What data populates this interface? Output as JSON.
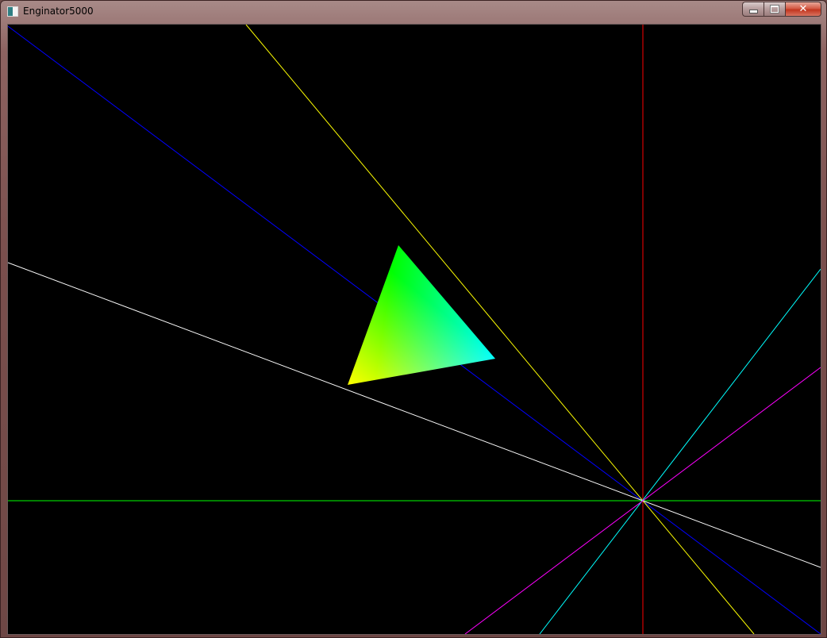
{
  "window": {
    "title": "Enginator5000",
    "controls": {
      "minimize": "minimize",
      "maximize": "maximize",
      "close": "✕"
    }
  },
  "scene": {
    "background": "#000000",
    "lines": [
      {
        "name": "red",
        "color": "#ff0000"
      },
      {
        "name": "green",
        "color": "#00ff00"
      },
      {
        "name": "blue",
        "color": "#0000ff"
      },
      {
        "name": "yellow",
        "color": "#ffff00"
      },
      {
        "name": "white",
        "color": "#ffffff"
      },
      {
        "name": "cyan",
        "color": "#00ffff"
      },
      {
        "name": "magenta",
        "color": "#ff00ff"
      }
    ],
    "triangle": {
      "vertex_colors": [
        "#00ff00",
        "#0000ff",
        "#ff0000"
      ]
    }
  }
}
